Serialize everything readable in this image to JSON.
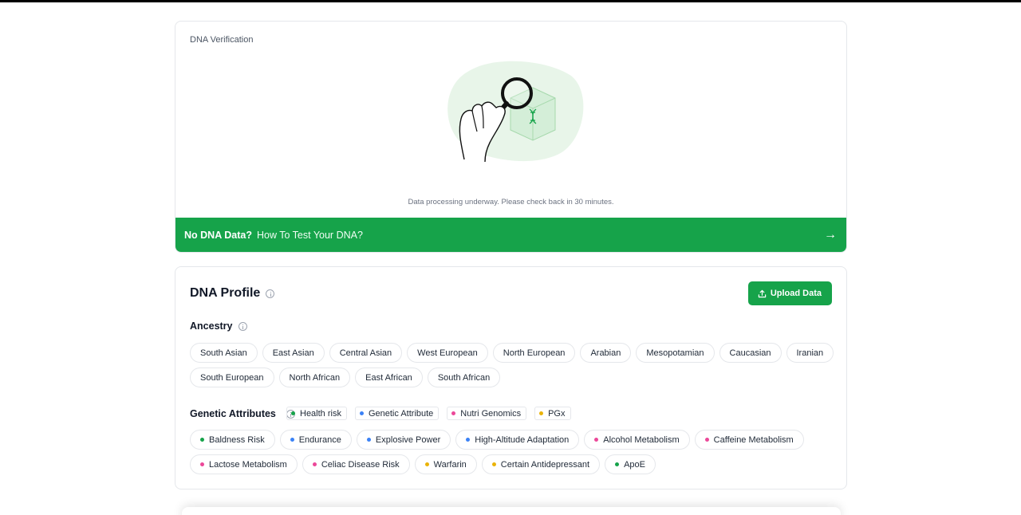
{
  "verification": {
    "title": "DNA Verification",
    "processing_text": "Data processing underway. Please check back in 30 minutes.",
    "cta_strong": "No DNA Data?",
    "cta_text": "How To Test Your DNA?",
    "cta_arrow": "→"
  },
  "profile": {
    "title": "DNA Profile",
    "upload_label": "Upload Data",
    "ancestry": {
      "label": "Ancestry",
      "items": [
        "South Asian",
        "East Asian",
        "Central Asian",
        "West European",
        "North European",
        "Arabian",
        "Mesopotamian",
        "Caucasian",
        "Iranian",
        "South European",
        "North African",
        "East African",
        "South African"
      ]
    },
    "genetic": {
      "label": "Genetic Attributes",
      "legend": [
        {
          "label": "Health risk",
          "color": "#16a34a"
        },
        {
          "label": "Genetic Attribute",
          "color": "#3b82f6"
        },
        {
          "label": "Nutri Genomics",
          "color": "#ec4899"
        },
        {
          "label": "PGx",
          "color": "#eab308"
        }
      ],
      "attributes": [
        {
          "label": "Baldness Risk",
          "color": "#16a34a"
        },
        {
          "label": "Endurance",
          "color": "#3b82f6"
        },
        {
          "label": "Explosive Power",
          "color": "#3b82f6"
        },
        {
          "label": "High-Altitude Adaptation",
          "color": "#3b82f6"
        },
        {
          "label": "Alcohol Metabolism",
          "color": "#ec4899"
        },
        {
          "label": "Caffeine Metabolism",
          "color": "#ec4899"
        },
        {
          "label": "Lactose Metabolism",
          "color": "#ec4899"
        },
        {
          "label": "Celiac Disease Risk",
          "color": "#ec4899"
        },
        {
          "label": "Warfarin",
          "color": "#eab308"
        },
        {
          "label": "Certain Antidepressant",
          "color": "#eab308"
        },
        {
          "label": "ApoE",
          "color": "#16a34a"
        }
      ]
    }
  },
  "colors": {
    "accent": "#16a34a"
  },
  "icons": {
    "illustration": "hand-magnifier-dna-illustration",
    "info": "info-icon",
    "upload": "upload-icon",
    "arrow": "arrow-right-icon"
  }
}
